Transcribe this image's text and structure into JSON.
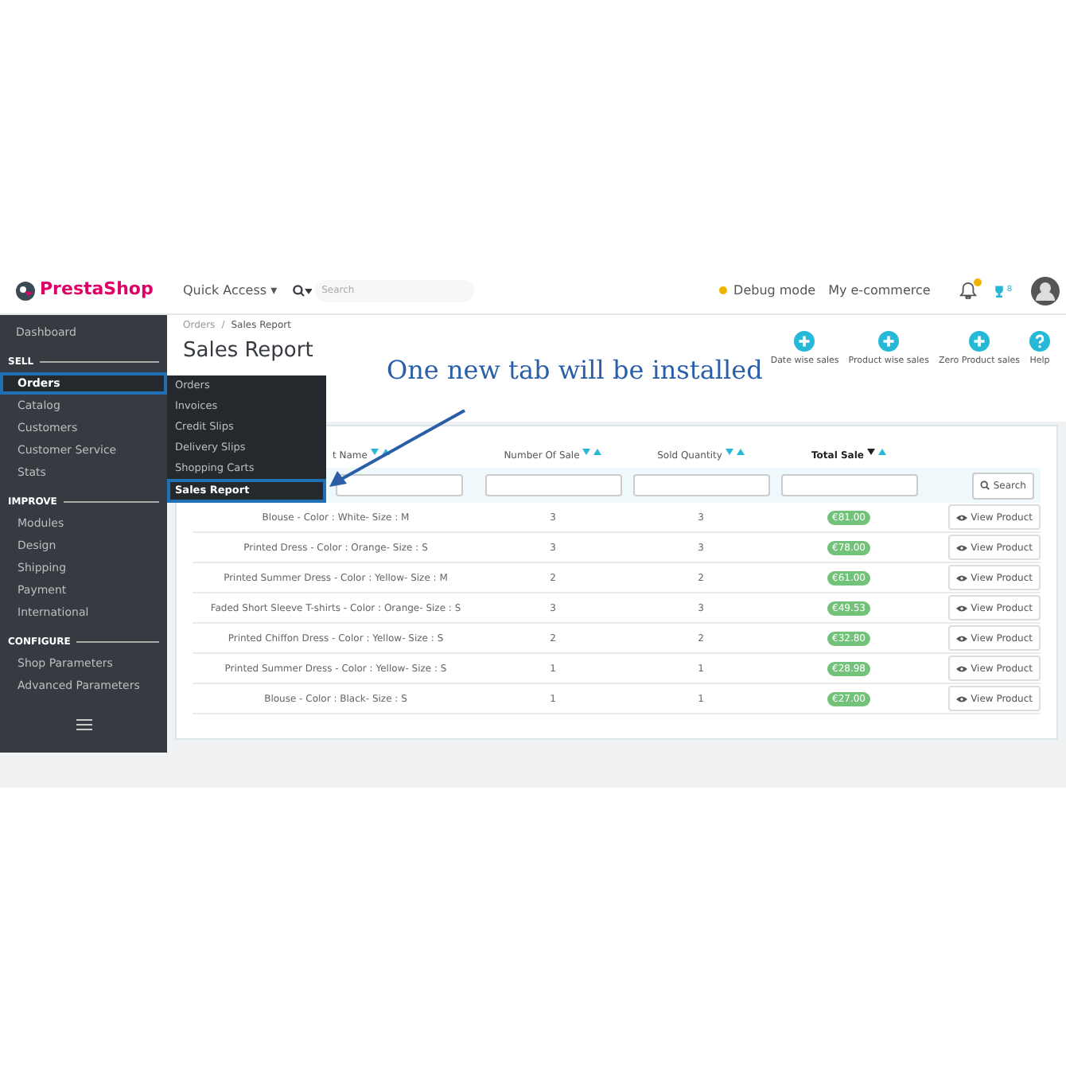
{
  "header": {
    "logo": "PrestaShop",
    "quick_access": "Quick Access ▾",
    "search": {
      "placeholder": "Search"
    },
    "debug": "Debug mode",
    "shop": "My e-commerce",
    "trophy_count": "8"
  },
  "sidebar": {
    "top": "Dashboard",
    "sections": [
      {
        "title": "SELL",
        "items": [
          {
            "label": "Orders",
            "selected": true
          },
          {
            "label": "Catalog",
            "selected": false
          },
          {
            "label": "Customers",
            "selected": false
          },
          {
            "label": "Customer Service",
            "selected": false
          },
          {
            "label": "Stats",
            "selected": false
          }
        ]
      },
      {
        "title": "IMPROVE",
        "items": [
          {
            "label": "Modules",
            "selected": false
          },
          {
            "label": "Design",
            "selected": false
          },
          {
            "label": "Shipping",
            "selected": false
          },
          {
            "label": "Payment",
            "selected": false
          },
          {
            "label": "International",
            "selected": false
          }
        ]
      },
      {
        "title": "CONFIGURE",
        "items": [
          {
            "label": "Shop Parameters",
            "selected": false
          },
          {
            "label": "Advanced Parameters",
            "selected": false
          }
        ]
      }
    ]
  },
  "submenu": [
    {
      "label": "Orders",
      "selected": false
    },
    {
      "label": "Invoices",
      "selected": false
    },
    {
      "label": "Credit Slips",
      "selected": false
    },
    {
      "label": "Delivery Slips",
      "selected": false
    },
    {
      "label": "Shopping Carts",
      "selected": false
    },
    {
      "label": "Sales Report",
      "selected": true
    }
  ],
  "breadcrumb": [
    "Orders",
    "Sales Report"
  ],
  "breadcrumb_separator": "/",
  "page_title": "Sales Report",
  "toolbar": [
    {
      "label": "Date wise sales",
      "kind": "add"
    },
    {
      "label": "Product wise sales",
      "kind": "add"
    },
    {
      "label": "Zero Product sales",
      "kind": "add"
    },
    {
      "label": "Help",
      "kind": "help"
    }
  ],
  "annotation": "One new tab will be installed",
  "table": {
    "columns": [
      {
        "label": "t Name",
        "sorted": false
      },
      {
        "label": "Number Of Sale",
        "sorted": false
      },
      {
        "label": "Sold Quantity",
        "sorted": false
      },
      {
        "label": "Total Sale",
        "sorted": true
      }
    ],
    "search_button": "Search",
    "rows": [
      {
        "name": "Blouse - Color : White- Size : M",
        "sales": "3",
        "quantity": "3",
        "total": "€81.00",
        "action": "View Product"
      },
      {
        "name": "Printed Dress - Color : Orange- Size : S",
        "sales": "3",
        "quantity": "3",
        "total": "€78.00",
        "action": "View Product"
      },
      {
        "name": "Printed Summer Dress - Color : Yellow- Size : M",
        "sales": "2",
        "quantity": "2",
        "total": "€61.00",
        "action": "View Product"
      },
      {
        "name": "Faded Short Sleeve T-shirts - Color : Orange- Size : S",
        "sales": "3",
        "quantity": "3",
        "total": "€49.53",
        "action": "View Product"
      },
      {
        "name": "Printed Chiffon Dress - Color : Yellow- Size : S",
        "sales": "2",
        "quantity": "2",
        "total": "€32.80",
        "action": "View Product"
      },
      {
        "name": "Printed Summer Dress - Color : Yellow- Size : S",
        "sales": "1",
        "quantity": "1",
        "total": "€28.98",
        "action": "View Product"
      },
      {
        "name": "Blouse - Color : Black- Size : S",
        "sales": "1",
        "quantity": "1",
        "total": "€27.00",
        "action": "View Product"
      }
    ]
  }
}
